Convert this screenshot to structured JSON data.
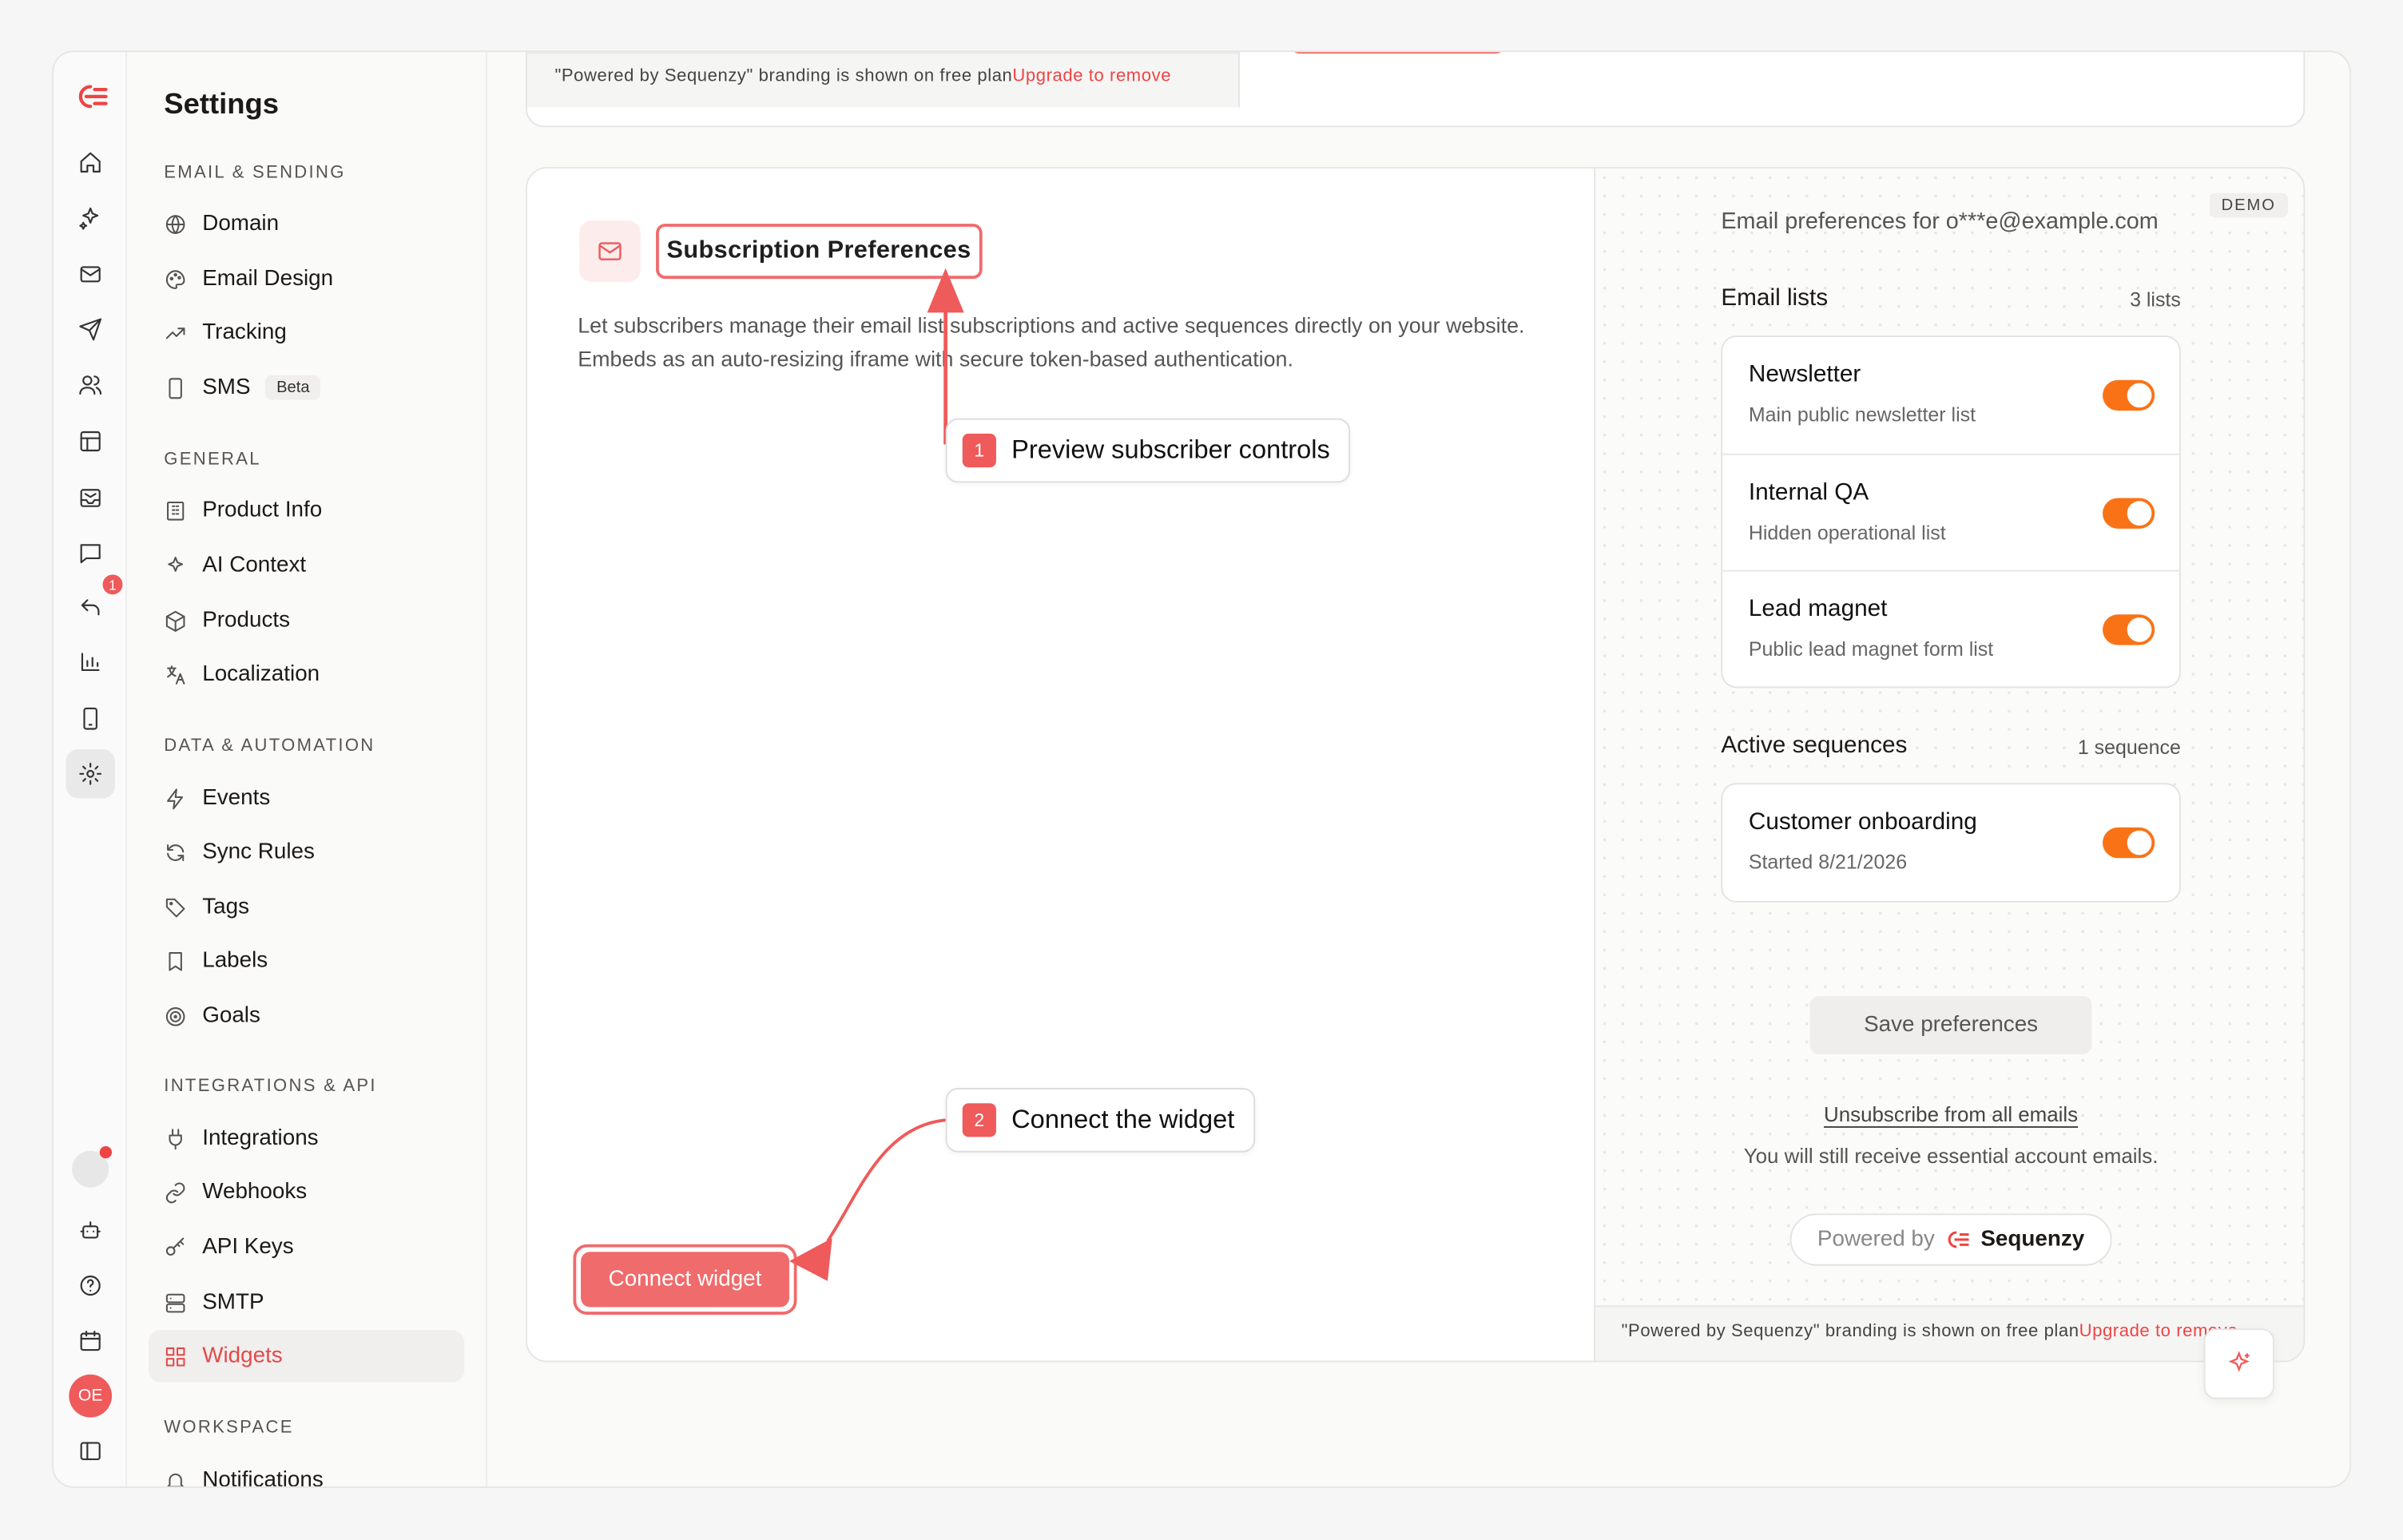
{
  "sidebar": {
    "title": "Settings",
    "sections": [
      {
        "label": "Email & Sending",
        "items": [
          {
            "label": "Domain"
          },
          {
            "label": "Email Design"
          },
          {
            "label": "Tracking"
          },
          {
            "label": "SMS",
            "badge": "Beta"
          }
        ]
      },
      {
        "label": "General",
        "items": [
          {
            "label": "Product Info"
          },
          {
            "label": "AI Context"
          },
          {
            "label": "Products"
          },
          {
            "label": "Localization"
          }
        ]
      },
      {
        "label": "Data & Automation",
        "items": [
          {
            "label": "Events"
          },
          {
            "label": "Sync Rules"
          },
          {
            "label": "Tags"
          },
          {
            "label": "Labels"
          },
          {
            "label": "Goals"
          }
        ]
      },
      {
        "label": "Integrations & API",
        "items": [
          {
            "label": "Integrations"
          },
          {
            "label": "Webhooks"
          },
          {
            "label": "API Keys"
          },
          {
            "label": "SMTP"
          },
          {
            "label": "Widgets",
            "active": true
          }
        ]
      },
      {
        "label": "Workspace",
        "items": [
          {
            "label": "Notifications"
          }
        ]
      }
    ]
  },
  "rail": {
    "notification_count": "1",
    "avatar_initials": "OE"
  },
  "top_card": {
    "branding_notice": "\"Powered by Sequenzy\" branding is shown on free plan",
    "upgrade_link": "Upgrade to remove"
  },
  "widget": {
    "title": "Subscription Preferences",
    "description": "Let subscribers manage their email list subscriptions and active sequences directly on your website. Embeds as an auto-resizing iframe with secure token-based authentication.",
    "connect_button": "Connect widget"
  },
  "callouts": [
    {
      "number": "1",
      "text": "Preview subscriber controls"
    },
    {
      "number": "2",
      "text": "Connect the widget"
    }
  ],
  "preview": {
    "demo_badge": "DEMO",
    "header": "Email preferences for o***e@example.com",
    "lists_title": "Email lists",
    "lists_count": "3 lists",
    "lists": [
      {
        "name": "Newsletter",
        "desc": "Main public newsletter list",
        "enabled": true
      },
      {
        "name": "Internal QA",
        "desc": "Hidden operational list",
        "enabled": true
      },
      {
        "name": "Lead magnet",
        "desc": "Public lead magnet form list",
        "enabled": true
      }
    ],
    "sequences_title": "Active sequences",
    "sequences_count": "1 sequence",
    "sequences": [
      {
        "name": "Customer onboarding",
        "desc": "Started 8/21/2026",
        "enabled": true
      }
    ],
    "save_button": "Save preferences",
    "unsubscribe_link": "Unsubscribe from all emails",
    "unsubscribe_note": "You will still receive essential account emails.",
    "powered_by": "Powered by",
    "brand": "Sequenzy",
    "branding_notice": "\"Powered by Sequenzy\" branding is shown on free plan",
    "upgrade_link": "Upgrade to remove"
  },
  "colors": {
    "accent": "#ef5a5a",
    "toggle": "#f97316"
  }
}
